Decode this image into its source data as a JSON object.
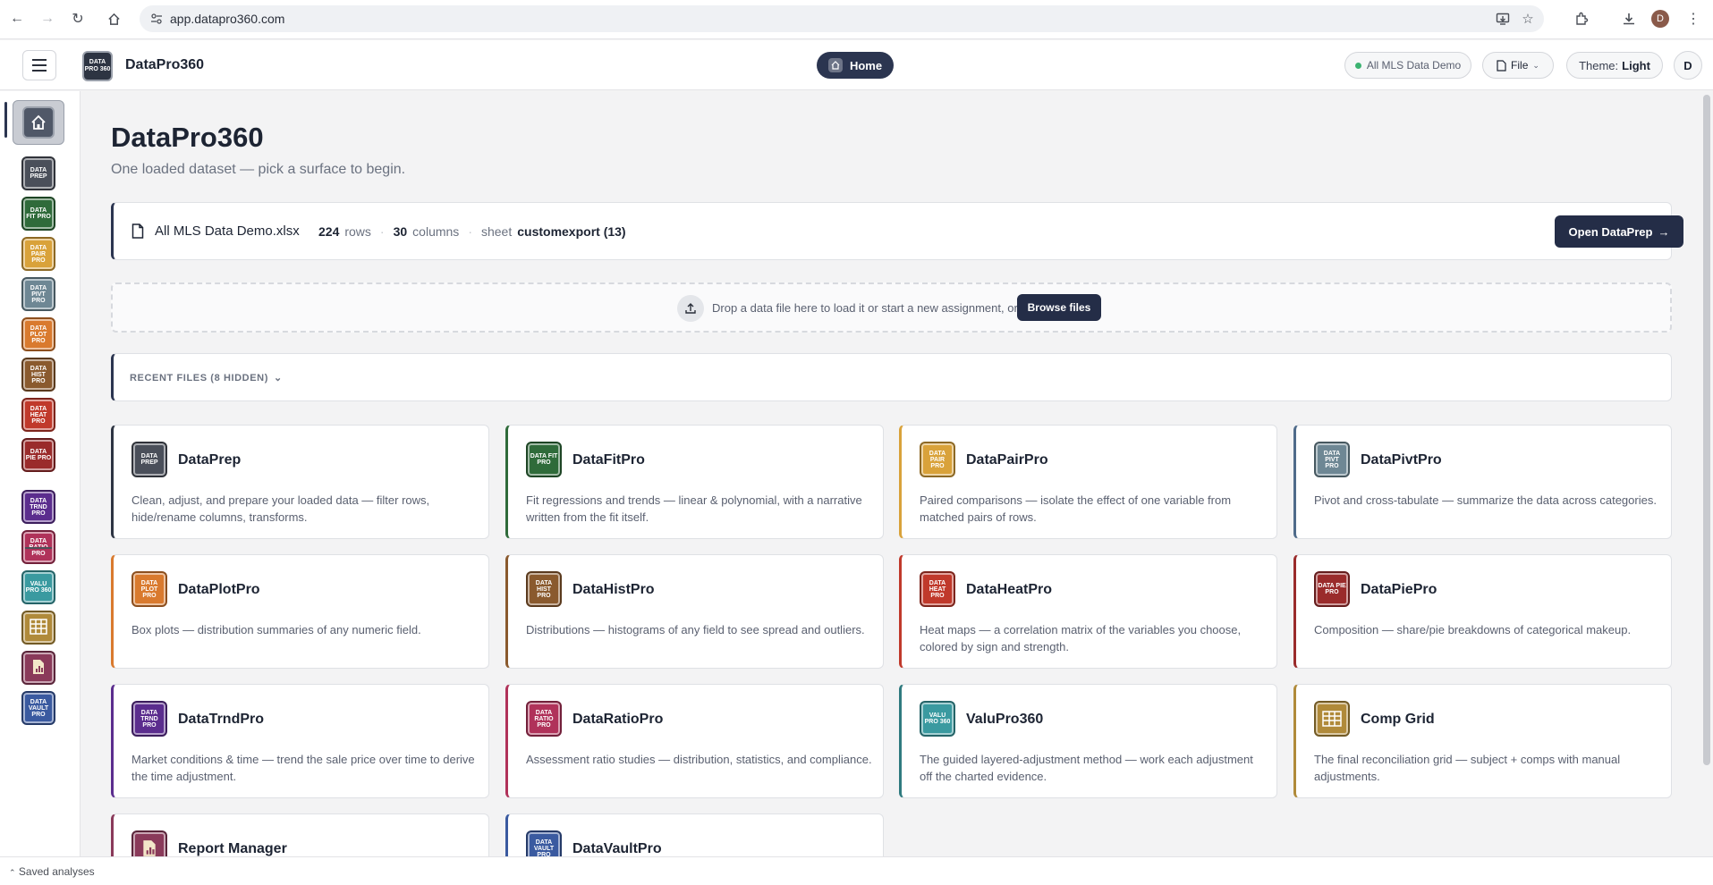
{
  "browser": {
    "url": "app.datapro360.com",
    "profile_initial": "D"
  },
  "header": {
    "brand_logo_text": "DATA PRO 360",
    "brand_name": "DataPro360",
    "home_label": "Home",
    "dataset_pill": "All MLS Data Demo",
    "file_label": "File",
    "theme_label": "Theme:",
    "theme_value": "Light",
    "user_initial": "D"
  },
  "sidebar": {
    "items": [
      {
        "text": "",
        "color": "#505868",
        "name": "home"
      },
      {
        "text": "DATA PREP",
        "color": "#4a4f5a",
        "name": "dataprep"
      },
      {
        "text": "DATA FIT PRO",
        "color": "#2f6b3a",
        "name": "datafitpro"
      },
      {
        "text": "DATA PAIR PRO",
        "color": "#d9a23a",
        "name": "datapairpro"
      },
      {
        "text": "DATA PIVT PRO",
        "color": "#6e8794",
        "name": "datapivtpro"
      },
      {
        "text": "DATA PLOT PRO",
        "color": "#d97a2e",
        "name": "dataplotpro"
      },
      {
        "text": "DATA HIST PRO",
        "color": "#8a5a2e",
        "name": "datahistpro"
      },
      {
        "text": "DATA HEAT PRO",
        "color": "#c0392b",
        "name": "dataheatpro"
      },
      {
        "text": "DATA PIE PRO",
        "color": "#9a2b2b",
        "name": "datapiepro"
      },
      {
        "text": "DATA TRND PRO",
        "color": "#5b2d8e",
        "name": "datatrndpro"
      },
      {
        "text": "DATA RATIO PRO",
        "color": "#b0325a",
        "name": "dataratiopro"
      },
      {
        "text": "VALU PRO 360",
        "color": "#3a9aa0",
        "name": "valupro360"
      },
      {
        "text": "",
        "color": "#b08a3a",
        "name": "comp-grid"
      },
      {
        "text": "",
        "color": "#8a3a5a",
        "name": "report-manager"
      },
      {
        "text": "DATA VAULT PRO",
        "color": "#3a5aa0",
        "name": "datavaultpro"
      }
    ]
  },
  "main": {
    "title": "DataPro360",
    "subtitle": "One loaded dataset — pick a surface to begin.",
    "dataset": {
      "filename": "All MLS Data Demo.xlsx",
      "rows_value": "224",
      "rows_label": "rows",
      "cols_value": "30",
      "cols_label": "columns",
      "sheet_label": "sheet",
      "sheet_value": "customexport (13)",
      "open_button": "Open DataPrep"
    },
    "dropzone": {
      "text": "Drop a data file here to load it or start a new assignment, or",
      "browse_button": "Browse files"
    },
    "recent_label": "RECENT FILES (8 HIDDEN)",
    "tiles": [
      {
        "name": "DataPrep",
        "icon_text": "DATA PREP",
        "color": "#4a4f5a",
        "accent": "#2d3442",
        "desc": "Clean, adjust, and prepare your loaded data — filter rows, hide/rename columns, transforms."
      },
      {
        "name": "DataFitPro",
        "icon_text": "DATA FIT PRO",
        "color": "#2f6b3a",
        "accent": "#2f6b3a",
        "desc": "Fit regressions and trends — linear & polynomial, with a narrative written from the fit itself."
      },
      {
        "name": "DataPairPro",
        "icon_text": "DATA PAIR PRO",
        "color": "#d9a23a",
        "accent": "#d9a23a",
        "desc": "Paired comparisons — isolate the effect of one variable from matched pairs of rows."
      },
      {
        "name": "DataPivtPro",
        "icon_text": "DATA PIVT PRO",
        "color": "#6e8794",
        "accent": "#4f6b8a",
        "desc": "Pivot and cross-tabulate — summarize the data across categories."
      },
      {
        "name": "DataPlotPro",
        "icon_text": "DATA PLOT PRO",
        "color": "#d97a2e",
        "accent": "#d97a2e",
        "desc": "Box plots — distribution summaries of any numeric field."
      },
      {
        "name": "DataHistPro",
        "icon_text": "DATA HIST PRO",
        "color": "#8a5a2e",
        "accent": "#8a5a2e",
        "desc": "Distributions — histograms of any field to see spread and outliers."
      },
      {
        "name": "DataHeatPro",
        "icon_text": "DATA HEAT PRO",
        "color": "#c0392b",
        "accent": "#c0392b",
        "desc": "Heat maps — a correlation matrix of the variables you choose, colored by sign and strength."
      },
      {
        "name": "DataPiePro",
        "icon_text": "DATA PIE PRO",
        "color": "#9a2b2b",
        "accent": "#9a2b2b",
        "desc": "Composition — share/pie breakdowns of categorical makeup."
      },
      {
        "name": "DataTrndPro",
        "icon_text": "DATA TRND PRO",
        "color": "#5b2d8e",
        "accent": "#5b2d8e",
        "desc": "Market conditions & time — trend the sale price over time to derive the time adjustment."
      },
      {
        "name": "DataRatioPro",
        "icon_text": "DATA RATIO PRO",
        "color": "#b0325a",
        "accent": "#b0325a",
        "desc": "Assessment ratio studies — distribution, statistics, and compliance."
      },
      {
        "name": "ValuPro360",
        "icon_text": "VALU PRO 360",
        "color": "#3a9aa0",
        "accent": "#2f7a7f",
        "desc": "The guided layered-adjustment method — work each adjustment off the charted evidence."
      },
      {
        "name": "Comp Grid",
        "icon_text": "",
        "color": "#b08a3a",
        "accent": "#b08a3a",
        "desc": "The final reconciliation grid — subject + comps with manual adjustments."
      },
      {
        "name": "Report Manager",
        "icon_text": "",
        "color": "#8a3a5a",
        "accent": "#8a3a5a",
        "desc": ""
      },
      {
        "name": "DataVaultPro",
        "icon_text": "DATA VAULT PRO",
        "color": "#3a5aa0",
        "accent": "#3a5aa0",
        "desc": ""
      }
    ]
  },
  "footer": {
    "saved_label": "Saved analyses"
  }
}
